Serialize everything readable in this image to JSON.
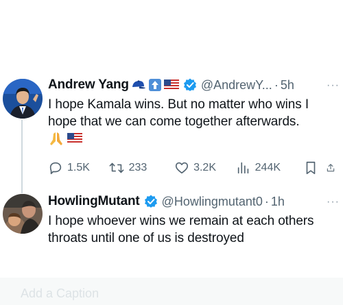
{
  "tweets": [
    {
      "name": "Andrew Yang",
      "handle": "@AndrewY...",
      "dot": "·",
      "time": "5h",
      "more": "···",
      "text": "I hope Kamala wins.  But no matter who wins I\nhope that we can come together afterwards.",
      "name_emojis": [
        "blue-cap-icon",
        "up-arrow-icon",
        "us-flag-icon"
      ],
      "trailing_emojis": [
        "praying-hands-icon",
        "us-flag-icon"
      ],
      "stats": {
        "replies": "1.5K",
        "reposts": "233",
        "likes": "3.2K",
        "views": "244K"
      }
    },
    {
      "name": "HowlingMutant",
      "handle": "@Howlingmutant0",
      "dot": "·",
      "time": "1h",
      "more": "···",
      "text": "I hope whoever wins we remain at each others\nthroats until one of us is destroyed"
    }
  ],
  "footer_hint": "Add a Caption",
  "colors": {
    "text": "#0f1419",
    "secondary": "#536471",
    "verified": "#1d9bf0",
    "thread_line": "#cfd9de"
  }
}
